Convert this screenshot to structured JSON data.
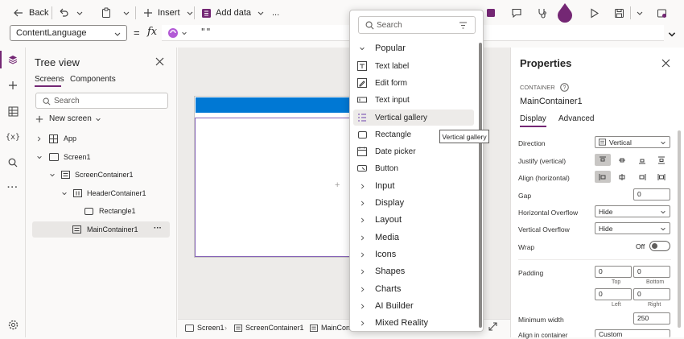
{
  "toolbar": {
    "back_label": "Back",
    "insert_label": "Insert",
    "add_data_label": "Add data",
    "more_label": "..."
  },
  "formula": {
    "property": "ContentLanguage",
    "equals": "=",
    "fx": "fx",
    "value": "\"\""
  },
  "tree": {
    "title": "Tree view",
    "tabs": [
      "Screens",
      "Components"
    ],
    "search_placeholder": "Search",
    "new_screen_label": "New screen",
    "items": [
      {
        "label": "App"
      },
      {
        "label": "Screen1"
      },
      {
        "label": "ScreenContainer1"
      },
      {
        "label": "HeaderContainer1"
      },
      {
        "label": "Rectangle1"
      },
      {
        "label": "MainContainer1"
      }
    ]
  },
  "canvas": {
    "breadcrumbs": [
      "Screen1",
      "ScreenContainer1",
      "MainCon"
    ]
  },
  "insert_menu": {
    "search_placeholder": "Search",
    "categories_top": "Popular",
    "items": [
      "Text label",
      "Edit form",
      "Text input",
      "Vertical gallery",
      "Rectangle",
      "Date picker",
      "Button"
    ],
    "categories": [
      "Input",
      "Display",
      "Layout",
      "Media",
      "Icons",
      "Shapes",
      "Charts",
      "AI Builder",
      "Mixed Reality"
    ],
    "tooltip": "Vertical gallery"
  },
  "properties": {
    "title": "Properties",
    "type_label": "CONTAINER",
    "name": "MainContainer1",
    "tabs": [
      "Display",
      "Advanced"
    ],
    "direction_label": "Direction",
    "direction_value": "Vertical",
    "justify_label": "Justify (vertical)",
    "align_label": "Align (horizontal)",
    "gap_label": "Gap",
    "gap_value": "0",
    "h_overflow_label": "Horizontal Overflow",
    "h_overflow_value": "Hide",
    "v_overflow_label": "Vertical Overflow",
    "v_overflow_value": "Hide",
    "wrap_label": "Wrap",
    "wrap_value": "Off",
    "padding_label": "Padding",
    "padding": {
      "top": "0",
      "bottom": "0",
      "left": "0",
      "right": "0"
    },
    "padding_captions": {
      "top": "Top",
      "bottom": "Bottom",
      "left": "Left",
      "right": "Right"
    },
    "min_width_label": "Minimum width",
    "min_width_value": "250",
    "align_in_container_label": "Align in container",
    "align_in_container_value": "Custom"
  },
  "colors": {
    "accent": "#0078d4",
    "brand": "#742774"
  }
}
